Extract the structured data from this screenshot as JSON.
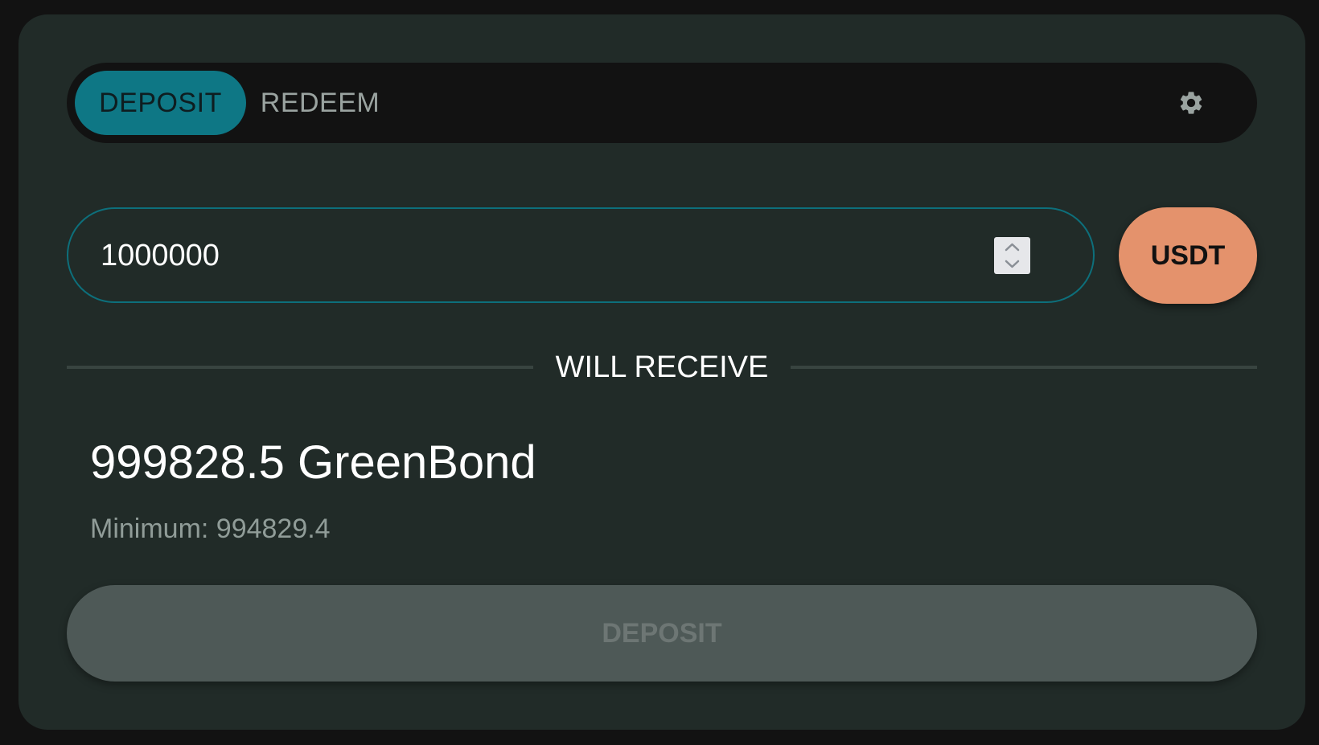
{
  "tabs": {
    "deposit_label": "DEPOSIT",
    "redeem_label": "REDEEM",
    "active": "DEPOSIT",
    "settings_icon": "gear-icon"
  },
  "amount": {
    "value": "1000000",
    "stepper_icon": "stepper-arrows-icon"
  },
  "currency": {
    "label": "USDT"
  },
  "receive": {
    "heading": "WILL RECEIVE",
    "amount_text": "999828.5 GreenBond",
    "minimum_text": "Minimum: 994829.4"
  },
  "action": {
    "deposit_label": "DEPOSIT",
    "enabled": false
  },
  "colors": {
    "accent": "#0e7785",
    "currency_button": "#e4926c",
    "card_background": "#212b28",
    "disabled_button": "#4e5957"
  }
}
